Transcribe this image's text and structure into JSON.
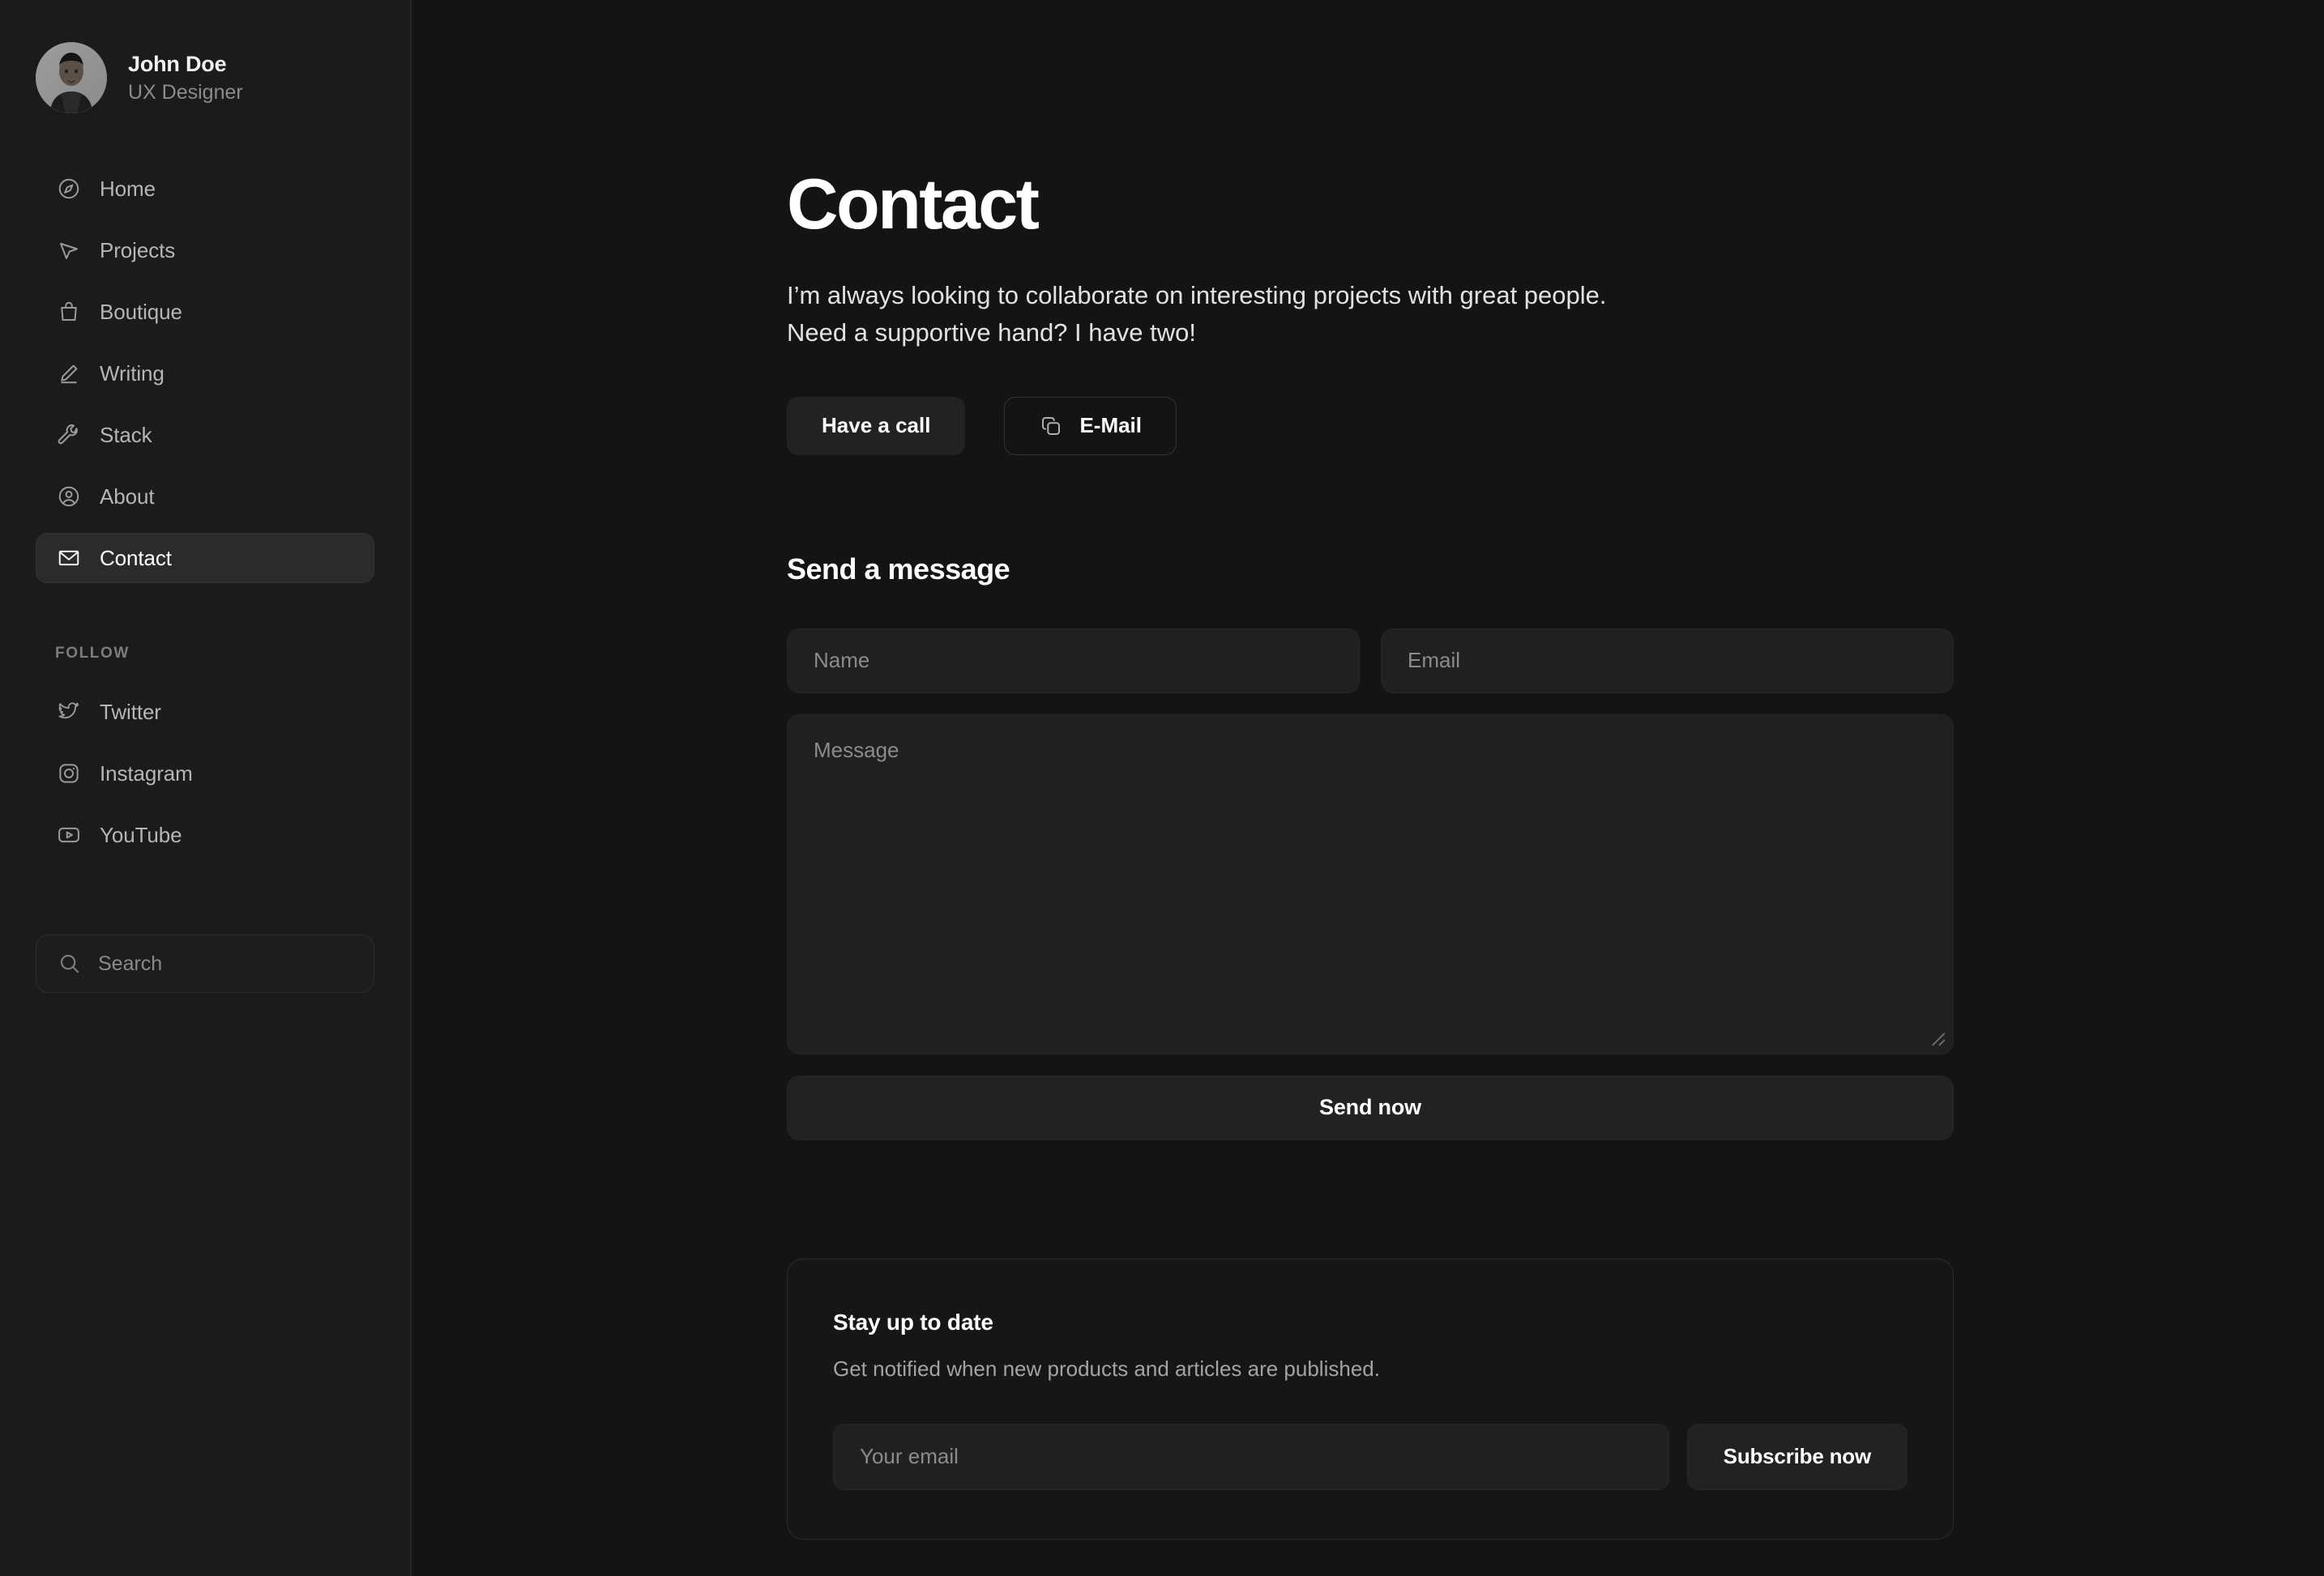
{
  "theme": {
    "page_bg": "#141414",
    "sidebar_bg": "#1b1b1b",
    "surface": "#202020",
    "border": "#2c2c2c",
    "text_primary": "#ffffff",
    "text_muted": "#8b8b8b"
  },
  "sidebar": {
    "profile": {
      "name": "John Doe",
      "role": "UX Designer",
      "avatar_icon": "user-portrait-avatar"
    },
    "nav_items": [
      {
        "label": "Home",
        "icon": "compass-icon",
        "active": false
      },
      {
        "label": "Projects",
        "icon": "cursor-arrow-icon",
        "active": false
      },
      {
        "label": "Boutique",
        "icon": "shopping-bag-icon",
        "active": false
      },
      {
        "label": "Writing",
        "icon": "pencil-icon",
        "active": false
      },
      {
        "label": "Stack",
        "icon": "wrench-icon",
        "active": false
      },
      {
        "label": "About",
        "icon": "user-circle-icon",
        "active": false
      },
      {
        "label": "Contact",
        "icon": "envelope-icon",
        "active": true
      }
    ],
    "follow_section_title": "FOLLOW",
    "follow_items": [
      {
        "label": "Twitter",
        "icon": "twitter-bird-icon"
      },
      {
        "label": "Instagram",
        "icon": "instagram-icon"
      },
      {
        "label": "YouTube",
        "icon": "youtube-play-icon"
      }
    ],
    "search": {
      "placeholder": "Search",
      "icon": "search-icon"
    }
  },
  "main": {
    "title": "Contact",
    "intro": "I’m always looking to collaborate on interesting projects with great people. Need a supportive hand? I have two!",
    "actions": [
      {
        "label": "Have a call",
        "icon": null,
        "style": "primary"
      },
      {
        "label": "E-Mail",
        "icon": "copy-icon",
        "style": "outline"
      }
    ],
    "form": {
      "heading": "Send a message",
      "name_placeholder": "Name",
      "email_placeholder": "Email",
      "message_placeholder": "Message",
      "submit_label": "Send now"
    },
    "newsletter": {
      "title": "Stay up to date",
      "description": "Get notified when new products and articles are published.",
      "email_placeholder": "Your email",
      "subscribe_label": "Subscribe now"
    }
  }
}
